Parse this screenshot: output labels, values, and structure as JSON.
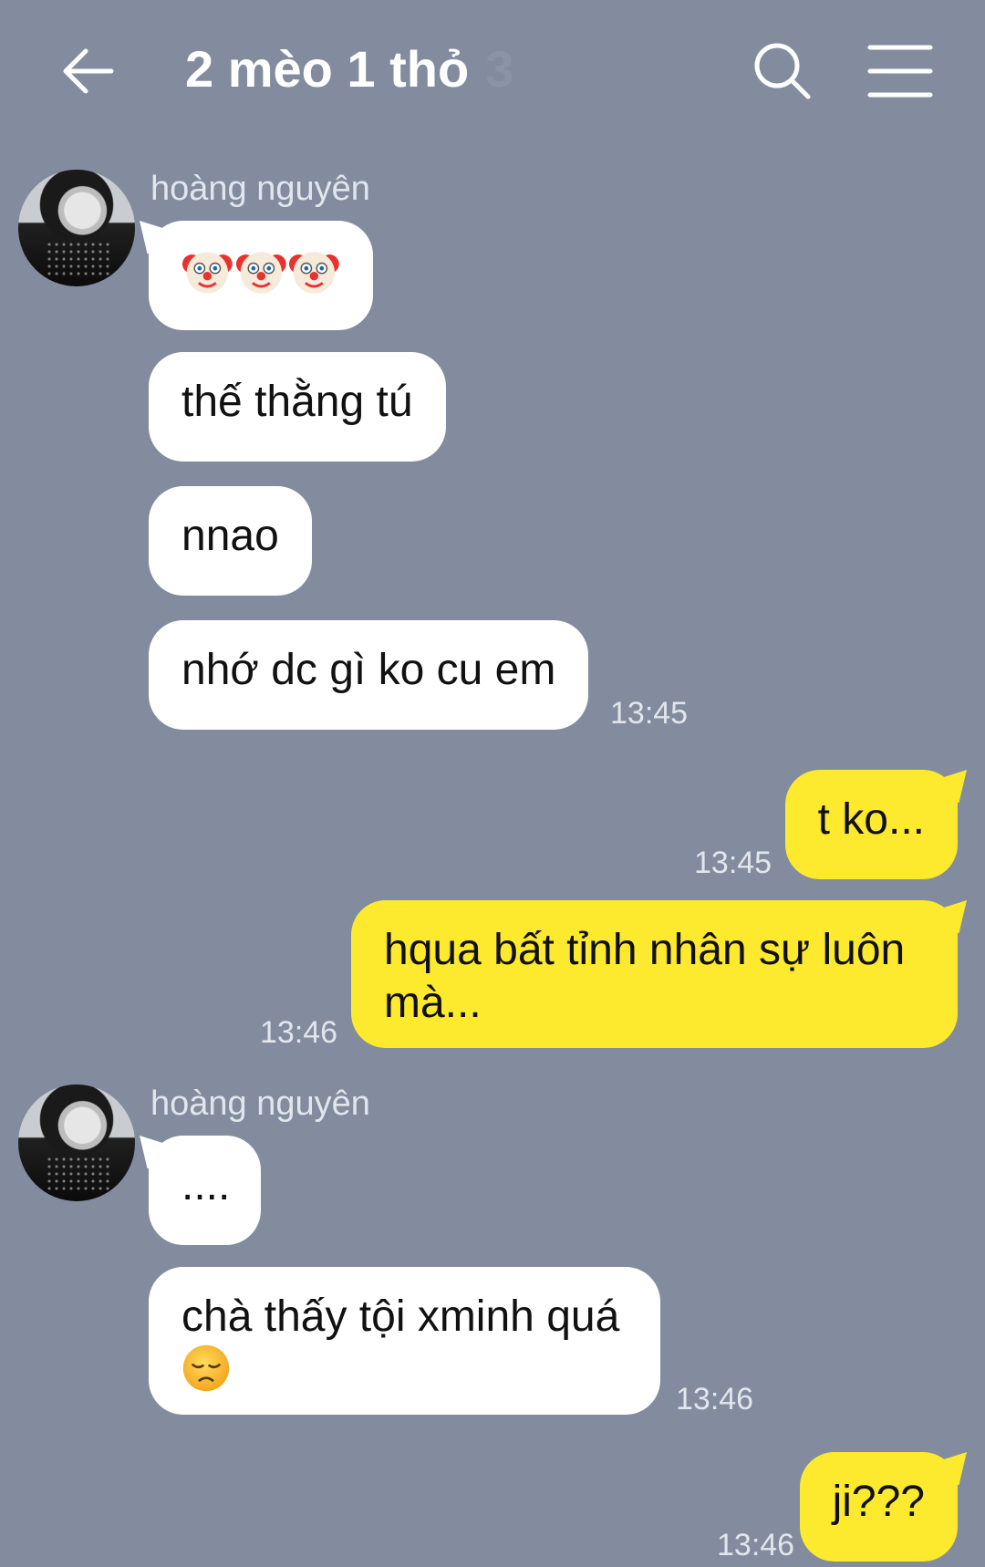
{
  "header": {
    "title": "2 mèo 1 thỏ",
    "member_count": "3",
    "icons": [
      "back-arrow-icon",
      "search-icon",
      "menu-icon"
    ]
  },
  "messages": [
    {
      "sender": "hoàng nguyên",
      "type": "emoji",
      "emoji": "clown-face x3",
      "text": "🤡🤡🤡"
    },
    {
      "sender": "hoàng nguyên",
      "text": "thế thằng tú"
    },
    {
      "sender": "hoàng nguyên",
      "text": "nnao"
    },
    {
      "sender": "hoàng nguyên",
      "text": "nhớ dc gì ko cu em",
      "time": "13:45"
    },
    {
      "sender": "me",
      "text": "t ko...",
      "time": "13:45"
    },
    {
      "sender": "me",
      "text": "hqua bất tỉnh nhân sự luôn mà...",
      "time": "13:46"
    },
    {
      "sender": "hoàng nguyên",
      "text": "...."
    },
    {
      "sender": "hoàng nguyên",
      "text": "chà thấy tội xminh quá",
      "emoji": "disappointed-face",
      "time": "13:46"
    },
    {
      "sender": "me",
      "text": "ji???",
      "time": "13:46"
    }
  ],
  "colors": {
    "background": "#828c9e",
    "incoming_bubble": "#ffffff",
    "outgoing_bubble": "#fde92d"
  }
}
